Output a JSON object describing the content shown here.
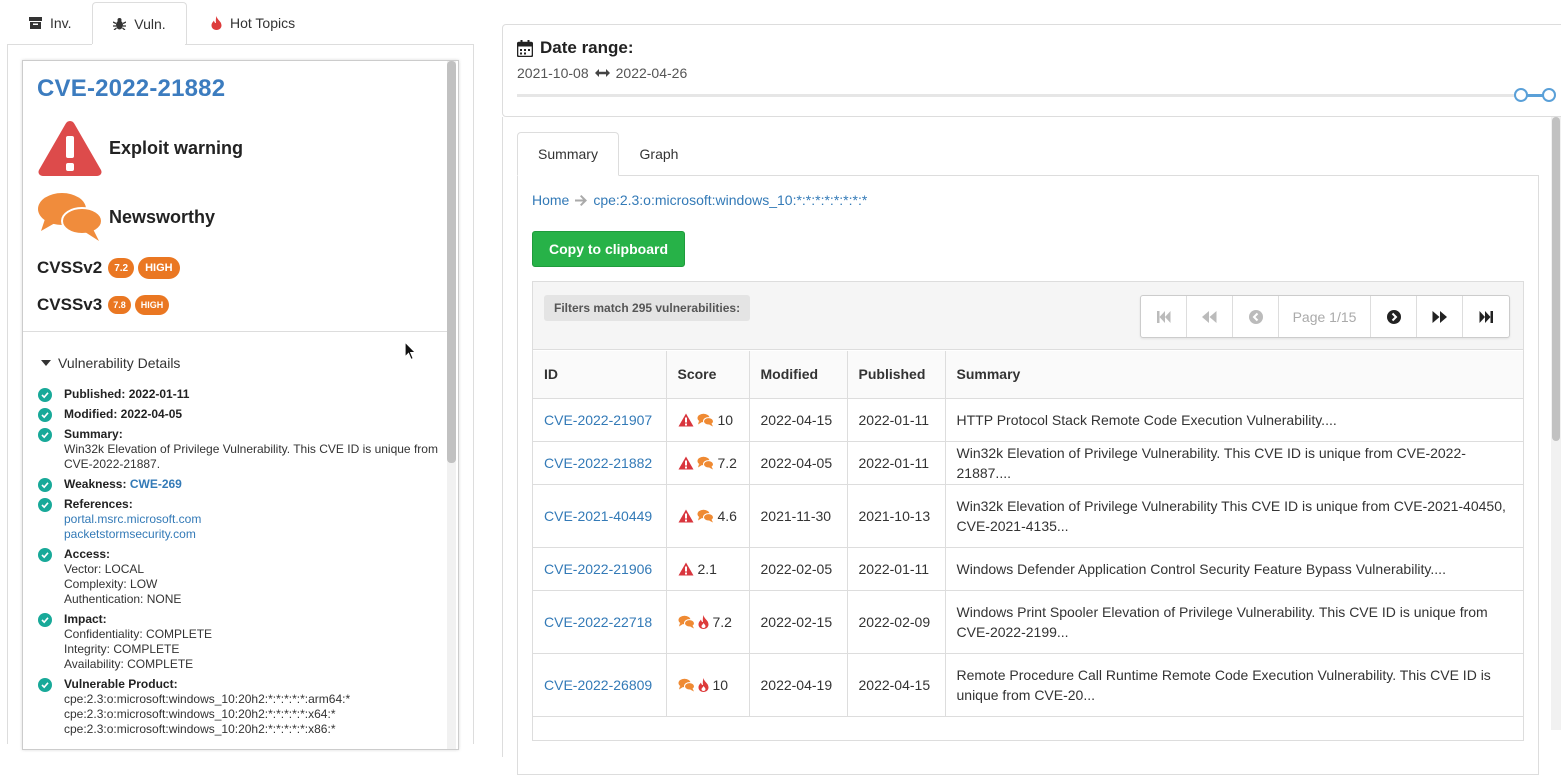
{
  "top_tabs": [
    {
      "label": "Inv.",
      "icon": "archive-icon"
    },
    {
      "label": "Vuln.",
      "icon": "bug-icon",
      "active": true
    },
    {
      "label": "Hot Topics",
      "icon": "fire-icon"
    }
  ],
  "cve": {
    "id": "CVE-2022-21882",
    "exploit_label": "Exploit warning",
    "newsworthy_label": "Newsworthy",
    "cvss": [
      {
        "label": "CVSSv2",
        "score": "7.2",
        "severity": "HIGH"
      },
      {
        "label": "CVSSv3",
        "score": "7.8",
        "severity": "HIGH"
      }
    ]
  },
  "details": {
    "header": "Vulnerability Details",
    "published_label": "Published:",
    "published": "2022-01-11",
    "modified_label": "Modified:",
    "modified": "2022-04-05",
    "summary_label": "Summary:",
    "summary": "Win32k Elevation of Privilege Vulnerability. This CVE ID is unique from CVE-2022-21887.",
    "weakness_label": "Weakness:",
    "weakness": "CWE-269",
    "references_label": "References:",
    "references": [
      "portal.msrc.microsoft.com",
      "packetstormsecurity.com"
    ],
    "access_label": "Access:",
    "access": [
      "Vector: LOCAL",
      "Complexity: LOW",
      "Authentication: NONE"
    ],
    "impact_label": "Impact:",
    "impact": [
      "Confidentiality: COMPLETE",
      "Integrity: COMPLETE",
      "Availability: COMPLETE"
    ],
    "product_label": "Vulnerable Product:",
    "products": [
      "cpe:2.3:o:microsoft:windows_10:20h2:*:*:*:*:*:arm64:*",
      "cpe:2.3:o:microsoft:windows_10:20h2:*:*:*:*:*:x64:*",
      "cpe:2.3:o:microsoft:windows_10:20h2:*:*:*:*:*:x86:*"
    ]
  },
  "date_range": {
    "title": "Date range:",
    "start": "2021-10-08",
    "end": "2022-04-26"
  },
  "sub_tabs": [
    {
      "label": "Summary",
      "active": true
    },
    {
      "label": "Graph"
    }
  ],
  "breadcrumb": {
    "home": "Home",
    "current": "cpe:2.3:o:microsoft:windows_10:*:*:*:*:*:*:*:*"
  },
  "copy_button": "Copy to clipboard",
  "filter_text": "Filters match 295 vulnerabilities:",
  "pagination": {
    "label": "Page 1/15"
  },
  "table": {
    "columns": [
      "ID",
      "Score",
      "Modified",
      "Published",
      "Summary"
    ],
    "rows": [
      {
        "id": "CVE-2022-21907",
        "icons": [
          "exploit",
          "news"
        ],
        "score": "10",
        "modified": "2022-04-15",
        "published": "2022-01-11",
        "summary": "HTTP Protocol Stack Remote Code Execution Vulnerability....",
        "tall": false
      },
      {
        "id": "CVE-2022-21882",
        "icons": [
          "exploit",
          "news"
        ],
        "score": "7.2",
        "modified": "2022-04-05",
        "published": "2022-01-11",
        "summary": "Win32k Elevation of Privilege Vulnerability. This CVE ID is unique from CVE-2022-21887....",
        "tall": false
      },
      {
        "id": "CVE-2021-40449",
        "icons": [
          "exploit",
          "news"
        ],
        "score": "4.6",
        "modified": "2021-11-30",
        "published": "2021-10-13",
        "summary": "Win32k Elevation of Privilege Vulnerability This CVE ID is unique from CVE-2021-40450, CVE-2021-4135...",
        "tall": true
      },
      {
        "id": "CVE-2022-21906",
        "icons": [
          "exploit"
        ],
        "score": "2.1",
        "modified": "2022-02-05",
        "published": "2022-01-11",
        "summary": "Windows Defender Application Control Security Feature Bypass Vulnerability....",
        "tall": false
      },
      {
        "id": "CVE-2022-22718",
        "icons": [
          "news",
          "fire"
        ],
        "score": "7.2",
        "modified": "2022-02-15",
        "published": "2022-02-09",
        "summary": "Windows Print Spooler Elevation of Privilege Vulnerability. This CVE ID is unique from CVE-2022-2199...",
        "tall": true
      },
      {
        "id": "CVE-2022-26809",
        "icons": [
          "news",
          "fire"
        ],
        "score": "10",
        "modified": "2022-04-19",
        "published": "2022-04-15",
        "summary": "Remote Procedure Call Runtime Remote Code Execution Vulnerability. This CVE ID is unique from CVE-20...",
        "tall": true
      }
    ]
  },
  "colors": {
    "link": "#337ab7",
    "exploit_red": "#dd4b4b",
    "news_orange": "#f08c3c",
    "badge_orange": "#ea7722",
    "check_teal": "#18a999",
    "button_green": "#27b248"
  }
}
